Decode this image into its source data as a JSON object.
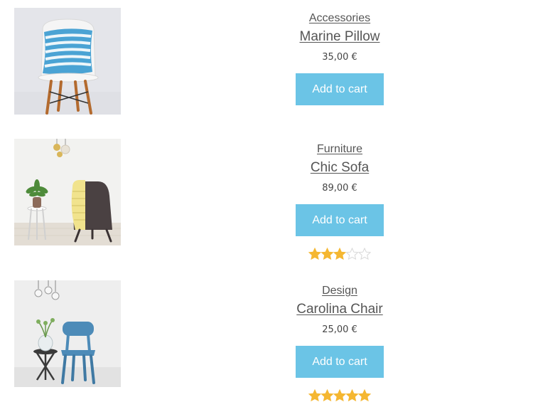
{
  "colors": {
    "button": "#6bc4e6",
    "text": "#555555",
    "star_filled": "#f5b731",
    "star_empty": "#d8d8d8"
  },
  "products": [
    {
      "image_icon": "pillow-on-chair-image",
      "category": "Accessories",
      "title": "Marine Pillow",
      "price": "35,00 €",
      "button_label": "Add to cart"
    },
    {
      "image_icon": "armchair-image",
      "category": "Furniture",
      "title": "Chic Sofa",
      "price": "89,00 €",
      "button_label": "Add to cart",
      "rating": 3,
      "rating_max": 5
    },
    {
      "image_icon": "blue-chair-image",
      "category": "Design",
      "title": "Carolina Chair",
      "price": "25,00 €",
      "button_label": "Add to cart",
      "rating": 5,
      "rating_max": 5
    }
  ]
}
